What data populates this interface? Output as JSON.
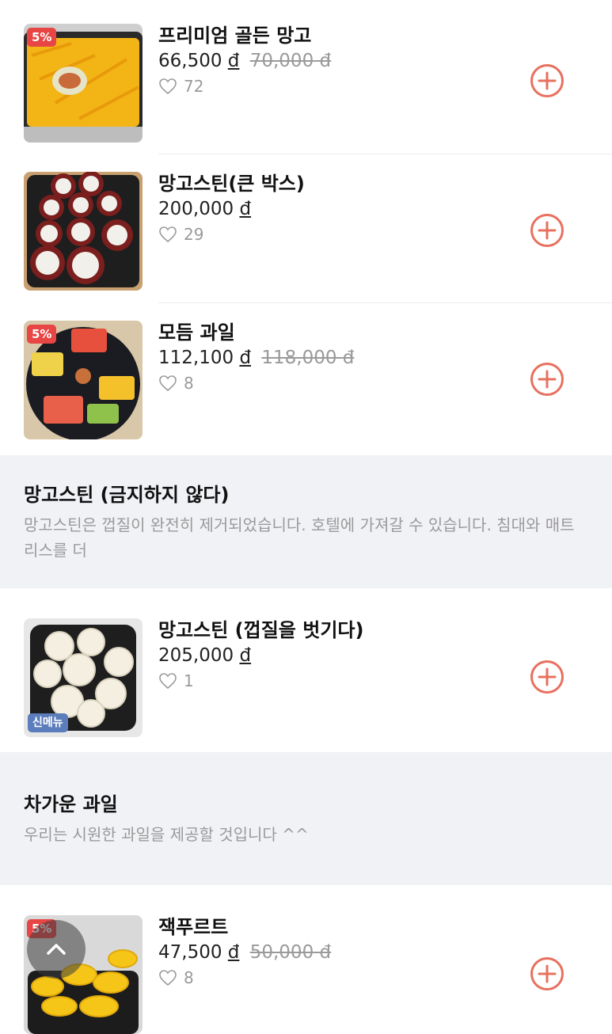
{
  "products_top": [
    {
      "name": "프리미엄 골든 망고",
      "price": "66,500",
      "old_price": "70,000",
      "currency": "đ",
      "likes": "72",
      "discount": "5%"
    },
    {
      "name": "망고스틴(큰 박스)",
      "price": "200,000",
      "old_price": "",
      "currency": "đ",
      "likes": "29",
      "discount": ""
    },
    {
      "name": "모듬 과일",
      "price": "112,100",
      "old_price": "118,000",
      "currency": "đ",
      "likes": "8",
      "discount": "5%"
    }
  ],
  "section_mangosteen": {
    "title": "망고스틴 (금지하지 않다)",
    "desc": "망고스틴은 껍질이 완전히 제거되었습니다. 호텔에 가져갈 수 있습니다. 침대와 매트리스를 더"
  },
  "product_peeled": {
    "name": "망고스틴 (껍질을 벗기다)",
    "price": "205,000",
    "currency": "đ",
    "likes": "1",
    "badge": "신메뉴"
  },
  "section_cold": {
    "title": "차가운 과일",
    "desc": "우리는 시원한 과일을 제공할 것입니다 ^^"
  },
  "product_jackfruit": {
    "name": "잭푸르트",
    "price": "47,500",
    "old_price": "50,000",
    "currency": "đ",
    "likes": "8",
    "discount": "5%"
  },
  "colors": {
    "accent": "#e8705e",
    "discount_badge": "#e84545",
    "new_badge": "#5b7dbb",
    "section_bg": "#f1f2f6"
  },
  "icons": {
    "like": "heart-outline-icon",
    "add": "plus-circle-icon",
    "scroll": "chevron-up-icon"
  }
}
